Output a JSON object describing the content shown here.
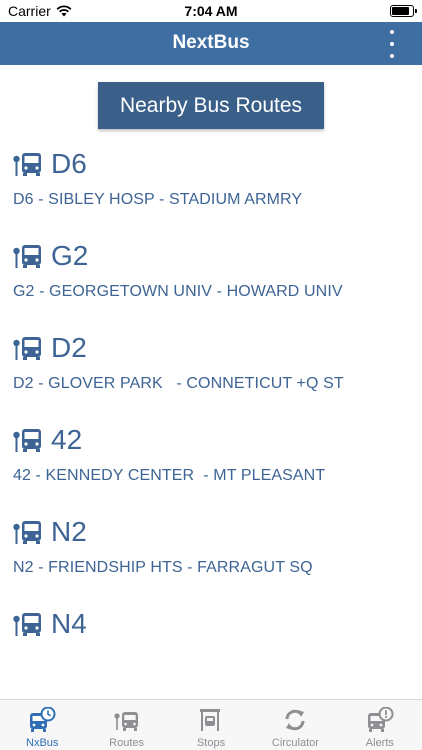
{
  "status_bar": {
    "carrier": "Carrier",
    "time": "7:04 AM"
  },
  "nav": {
    "title": "NextBus"
  },
  "section": {
    "label": "Nearby Bus Routes"
  },
  "routes": [
    {
      "number": "D6",
      "description": "D6 - SIBLEY HOSP - STADIUM ARMRY"
    },
    {
      "number": "G2",
      "description": "G2 - GEORGETOWN UNIV - HOWARD UNIV"
    },
    {
      "number": "D2",
      "description": "D2 - GLOVER PARK   - CONNETICUT +Q ST"
    },
    {
      "number": "42",
      "description": "42 - KENNEDY CENTER  - MT PLEASANT"
    },
    {
      "number": "N2",
      "description": "N2 - FRIENDSHIP HTS - FARRAGUT SQ"
    },
    {
      "number": "N4",
      "description": ""
    }
  ],
  "tabs": [
    {
      "label": "NxBus",
      "icon": "bus-clock-icon",
      "active": true
    },
    {
      "label": "Routes",
      "icon": "bus-stop-icon",
      "active": false
    },
    {
      "label": "Stops",
      "icon": "stop-sign-icon",
      "active": false
    },
    {
      "label": "Circulator",
      "icon": "refresh-icon",
      "active": false
    },
    {
      "label": "Alerts",
      "icon": "bus-alert-icon",
      "active": false
    }
  ],
  "colors": {
    "nav": "#3f6ea3",
    "button": "#3a5f88",
    "route_text": "#3d6495",
    "tab_active": "#2f6eb5",
    "tab_inactive": "#8e8e93"
  }
}
